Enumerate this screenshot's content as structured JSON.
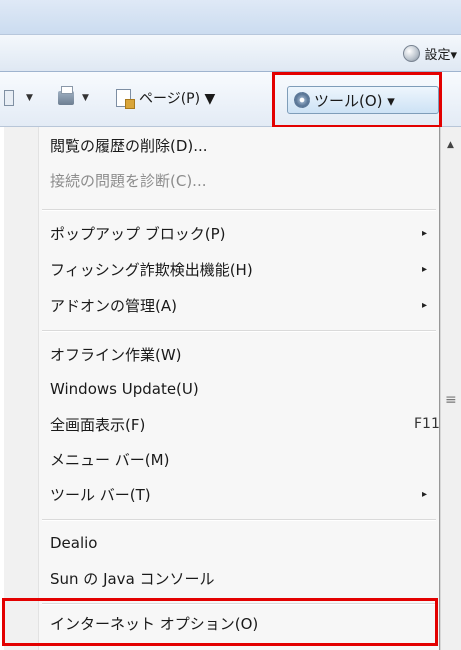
{
  "command_bar": {
    "settings_label": "設定▾"
  },
  "toolbar": {
    "print_arrow": "▼",
    "page_label": "ページ(P) ▼",
    "tools_label": "ツール(O) ▾",
    "more": "»"
  },
  "menu": {
    "items": [
      {
        "label": "閲覧の履歴の削除(D)...",
        "enabled": true
      },
      {
        "label": "接続の問題を診断(C)...",
        "enabled": false
      },
      {
        "label": "ポップアップ ブロック(P)",
        "submenu": true
      },
      {
        "label": "フィッシング詐欺検出機能(H)",
        "submenu": true
      },
      {
        "label": "アドオンの管理(A)",
        "submenu": true
      },
      {
        "label": "オフライン作業(W)"
      },
      {
        "label": "Windows Update(U)"
      },
      {
        "label": "全画面表示(F)",
        "shortcut": "F11"
      },
      {
        "label": "メニュー バー(M)"
      },
      {
        "label": "ツール バー(T)",
        "submenu": true
      },
      {
        "label": "Dealio"
      },
      {
        "label": "Sun の Java コンソール"
      },
      {
        "label": "インターネット オプション(O)"
      }
    ],
    "submenu_arrow": "▸"
  },
  "colors": {
    "highlight_box": "#e30000",
    "tools_button_bg": "#cde2f5"
  }
}
